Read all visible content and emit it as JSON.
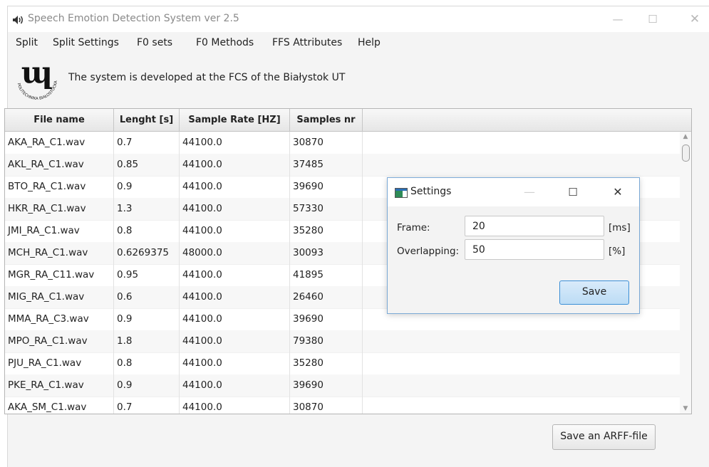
{
  "window": {
    "title": "Speech Emotion Detection System ver 2.5",
    "controls": {
      "minimize": "—",
      "maximize": "☐",
      "close": "✕"
    }
  },
  "menu": [
    "Split",
    "Split Settings",
    "F0 sets",
    "F0 Methods",
    "FFS Attributes",
    "Help"
  ],
  "header": {
    "logo_mark": "ɰ",
    "logo_text": "POLITECHNIKA BIAŁOSTOCKA",
    "info": "The system is developed at the FCS of the Białystok UT"
  },
  "table": {
    "columns": [
      "File name",
      "Lenght [s]",
      "Sample Rate [HZ]",
      "Samples nr"
    ],
    "rows": [
      [
        "AKA_RA_C1.wav",
        "0.7",
        "44100.0",
        "30870"
      ],
      [
        "AKL_RA_C1.wav",
        "0.85",
        "44100.0",
        "37485"
      ],
      [
        "BTO_RA_C1.wav",
        "0.9",
        "44100.0",
        "39690"
      ],
      [
        "HKR_RA_C1.wav",
        "1.3",
        "44100.0",
        "57330"
      ],
      [
        "JMI_RA_C1.wav",
        "0.8",
        "44100.0",
        "35280"
      ],
      [
        "MCH_RA_C1.wav",
        "0.6269375",
        "48000.0",
        "30093"
      ],
      [
        "MGR_RA_C11.wav",
        "0.95",
        "44100.0",
        "41895"
      ],
      [
        "MIG_RA_C1.wav",
        "0.6",
        "44100.0",
        "26460"
      ],
      [
        "MMA_RA_C3.wav",
        "0.9",
        "44100.0",
        "39690"
      ],
      [
        "MPO_RA_C1.wav",
        "1.8",
        "44100.0",
        "79380"
      ],
      [
        "PJU_RA_C1.wav",
        "0.8",
        "44100.0",
        "35280"
      ],
      [
        "PKE_RA_C1.wav",
        "0.9",
        "44100.0",
        "39690"
      ],
      [
        "AKA_SM_C1.wav",
        "0.7",
        "44100.0",
        "30870"
      ]
    ]
  },
  "save_arff_label": "Save an ARFF-file",
  "dialog": {
    "title": "Settings",
    "controls": {
      "minimize": "—",
      "maximize": "☐",
      "close": "✕"
    },
    "frame_label": "Frame:",
    "frame_value": "20",
    "frame_unit": "[ms]",
    "overlap_label": "Overlapping:",
    "overlap_value": "50",
    "overlap_unit": "[%]",
    "save_label": "Save"
  },
  "colors": {
    "dialog_border": "#7aa9d6",
    "dialog_button": "#bcdcf5",
    "title_text": "#8a8a8a"
  }
}
